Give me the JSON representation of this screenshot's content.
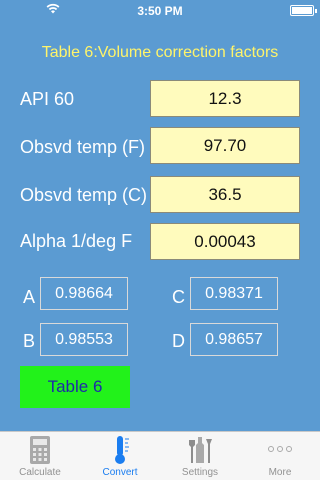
{
  "status_bar": {
    "time": "3:50 PM"
  },
  "title": "Table 6:Volume correction factors",
  "inputs": [
    {
      "label": "API 60",
      "value": "12.3"
    },
    {
      "label": "Obsvd temp (F)",
      "value": "97.70"
    },
    {
      "label": "Obsvd temp (C)",
      "value": "36.5"
    },
    {
      "label": "Alpha 1/deg F",
      "value": "0.00043"
    }
  ],
  "factors": {
    "A": {
      "letter": "A",
      "value": "0.98664"
    },
    "B": {
      "letter": "B",
      "value": "0.98553"
    },
    "C": {
      "letter": "C",
      "value": "0.98371"
    },
    "D": {
      "letter": "D",
      "value": "0.98657"
    }
  },
  "table6_button": {
    "label": "Table 6",
    "color": "#22f21a"
  },
  "tabs": [
    {
      "label": "Calculate",
      "icon": "calculator-icon"
    },
    {
      "label": "Convert",
      "icon": "thermometer-icon",
      "active": true
    },
    {
      "label": "Settings",
      "icon": "tools-icon"
    },
    {
      "label": "More",
      "icon": "more-icon"
    }
  ],
  "colors": {
    "background": "#5b9bd2",
    "title": "#fff46a",
    "input_bg": "#fffbbd",
    "active_tab": "#1a7df0"
  }
}
